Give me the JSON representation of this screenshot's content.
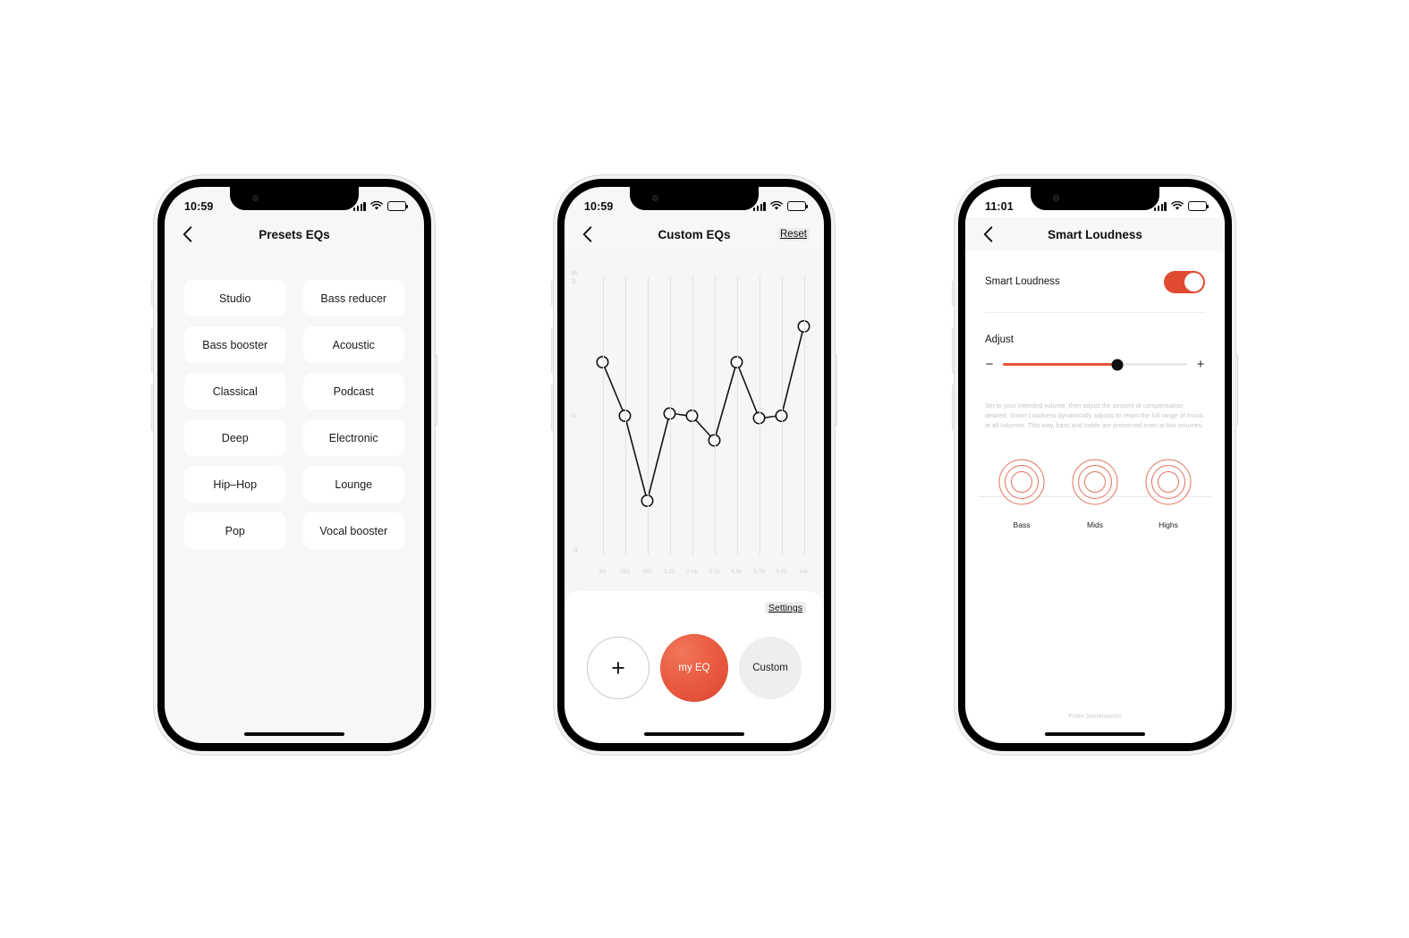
{
  "phones": {
    "presets": {
      "status": {
        "time": "10:59",
        "signal_icon": "cellular-bars-icon",
        "wifi_icon": "wifi-icon",
        "battery_icon": "battery-icon"
      },
      "nav": {
        "back_icon": "chevron-left-icon",
        "title": "Presets EQs"
      },
      "items": [
        "Studio",
        "Bass reducer",
        "Bass booster",
        "Acoustic",
        "Classical",
        "Podcast",
        "Deep",
        "Electronic",
        "Hip–Hop",
        "Lounge",
        "Pop",
        "Vocal booster"
      ]
    },
    "custom": {
      "status": {
        "time": "10:59",
        "signal_icon": "cellular-bars-icon",
        "wifi_icon": "wifi-icon",
        "battery_icon": "battery-icon"
      },
      "nav": {
        "back_icon": "chevron-left-icon",
        "title": "Custom EQs",
        "action": "Reset"
      },
      "settings_link": "Settings",
      "buttons": {
        "add": "+",
        "my_eq": "my EQ",
        "custom": "Custom"
      }
    },
    "loudness": {
      "status": {
        "time": "11:01",
        "signal_icon": "cellular-bars-icon",
        "wifi_icon": "wifi-icon",
        "battery_icon": "battery-icon"
      },
      "nav": {
        "back_icon": "chevron-left-icon",
        "title": "Smart Loudness"
      },
      "toggle_row_label": "Smart Loudness",
      "toggle_state": "on",
      "adjust_label": "Adjust",
      "slider_value_percent": 62,
      "slider_minus": "−",
      "slider_plus": "+",
      "description": "Set to your intended volume, then adjust the amount of compensation desired. Smart Loudness dynamically adjusts to retain the full range of music at all volumes. This way, bass and treble are preserved even at low volumes.",
      "bands": [
        "Bass",
        "Mids",
        "Highs"
      ],
      "footer": "From Sonarworks"
    }
  },
  "colors": {
    "accent_red": "#e4543a",
    "my_eq_red": "#ea5d42",
    "screen_bg": "#f7f7f7",
    "chip_white": "#ffffff",
    "band_ring": "#e0725c"
  },
  "chart_data": {
    "type": "line",
    "title": "Custom EQs",
    "xlabel": "",
    "ylabel": "db",
    "ylim": [
      -3,
      3
    ],
    "yticks": [
      3,
      0,
      -3
    ],
    "ytick_labels": [
      "3",
      "0",
      "-3"
    ],
    "grid": "vertical",
    "categories": [
      "69",
      "282",
      "682",
      "1.2k",
      "2.0k",
      "3.1k",
      "4.6k",
      "6.7k",
      "9.8k",
      "14k"
    ],
    "values": [
      1.2,
      0.0,
      -1.9,
      0.05,
      0.0,
      -0.55,
      1.2,
      -0.05,
      0.0,
      2.0
    ],
    "series": [
      {
        "name": "my EQ",
        "values": [
          1.2,
          0.0,
          -1.9,
          0.05,
          0.0,
          -0.55,
          1.2,
          -0.05,
          0.0,
          2.0
        ]
      }
    ]
  }
}
